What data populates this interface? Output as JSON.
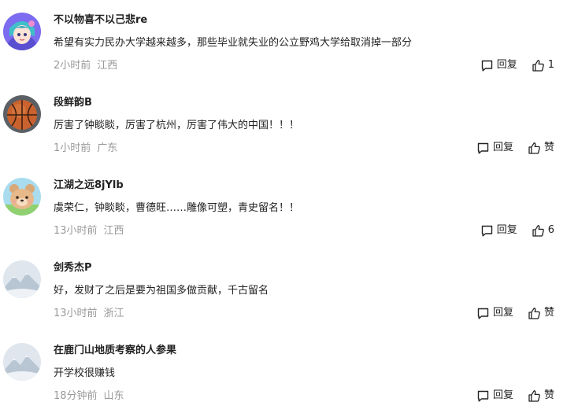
{
  "comments": [
    {
      "avatar": "anime-girl-avatar",
      "username": "不以物喜不以己悲re",
      "content": "希望有实力民办大学越来越多，那些毕业就失业的公立野鸡大学给取消掉一部分",
      "time": "2小时前",
      "location": "江西",
      "reply_label": "回复",
      "like_label": "1"
    },
    {
      "avatar": "basketball-avatar",
      "username": "段鲜韵B",
      "content": "厉害了钟睒睒，厉害了杭州，厉害了伟大的中国！！！",
      "time": "1小时前",
      "location": "广东",
      "reply_label": "回复",
      "like_label": "赞"
    },
    {
      "avatar": "cartoon-bear-avatar",
      "username": "江湖之远8jYlb",
      "content": "虞荣仁，钟睒睒，曹德旺……雕像可塑，青史留名！！",
      "time": "13小时前",
      "location": "江西",
      "reply_label": "回复",
      "like_label": "6"
    },
    {
      "avatar": "default-landscape-avatar",
      "username": "剑秀杰P",
      "content": "好，发财了之后是要为祖国多做贡献，千古留名",
      "time": "13小时前",
      "location": "浙江",
      "reply_label": "回复",
      "like_label": "赞"
    },
    {
      "avatar": "default-landscape-avatar",
      "username": "在鹿门山地质考察的人参果",
      "content": "开学校很赚钱",
      "time": "18分钟前",
      "location": "山东",
      "reply_label": "回复",
      "like_label": "赞"
    }
  ],
  "icons": {
    "reply": "comment-bubble-icon",
    "like": "thumbs-up-icon"
  },
  "colors": {
    "text": "#222222",
    "meta": "#999999"
  }
}
